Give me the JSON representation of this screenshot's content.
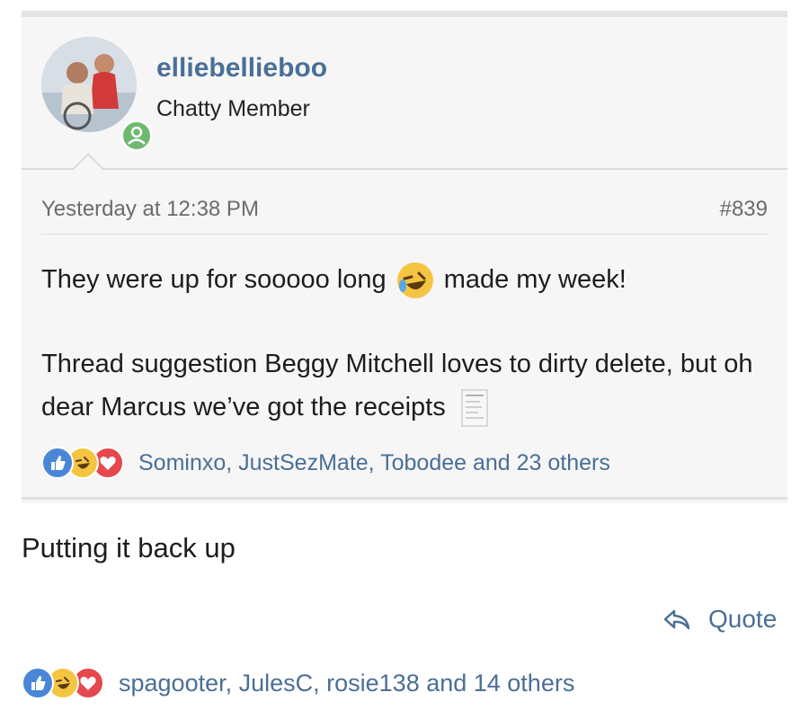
{
  "quoted_post": {
    "author": {
      "username": "elliebellieboo",
      "title": "Chatty Member",
      "avatar_icon": "avatar-photo",
      "online_badge_icon": "user-online-icon",
      "online_color": "#6fb870"
    },
    "timestamp": "Yesterday at 12:38 PM",
    "post_number": "#839",
    "body": {
      "line1_before": "They were up for sooooo long",
      "line1_emoji_icon": "tears-of-joy-emoji-icon",
      "line1_after": "made my week!",
      "para2_text": "Thread suggestion Beggy Mitchell loves to dirty delete, but oh dear Marcus we’ve got the receipts",
      "para2_emoji_icon": "receipt-emoji-icon"
    },
    "reactions": {
      "icons": [
        "like-icon",
        "laugh-icon",
        "love-icon"
      ],
      "text": "Sominxo, JustSezMate, Tobodee and 23 others"
    }
  },
  "reply": {
    "text": "Putting it back up",
    "quote_label": "Quote",
    "quote_icon": "reply-arrow-icon",
    "reactions": {
      "icons": [
        "like-icon",
        "laugh-icon",
        "love-icon"
      ],
      "text": "spagooter, JulesC, rosie138 and 14 others"
    }
  },
  "colors": {
    "link": "#4a6f97",
    "quote_background": "#f6f6f6",
    "like": "#4a86d8",
    "laugh": "#f5c542",
    "love": "#e5484d"
  }
}
